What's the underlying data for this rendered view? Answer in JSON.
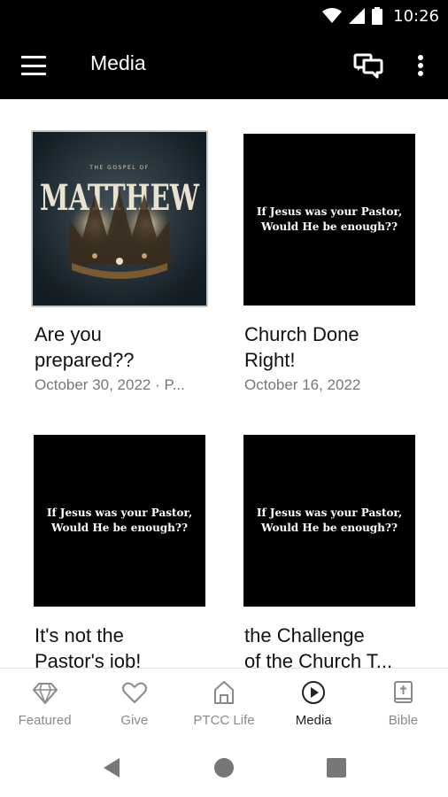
{
  "status_bar": {
    "time": "10:26"
  },
  "app_bar": {
    "title": "Media"
  },
  "thumbnail_text": "If Jesus was your Pastor,\nWould He be  enough??",
  "matthew_art": {
    "top": "THE GOSPEL OF",
    "word": "MATTHEW"
  },
  "media_items": [
    {
      "title": "Are you\nprepared??",
      "date": "October 30, 2022 · P..."
    },
    {
      "title": "Church Done\nRight!",
      "date": "October 16, 2022"
    },
    {
      "title": "It's not the\nPastor's job!",
      "date": ""
    },
    {
      "title": "the Challenge\nof the Church T...",
      "date": ""
    }
  ],
  "bottom_nav": [
    {
      "label": "Featured",
      "icon": "diamond-icon"
    },
    {
      "label": "Give",
      "icon": "heart-icon"
    },
    {
      "label": "PTCC Life",
      "icon": "home-icon"
    },
    {
      "label": "Media",
      "icon": "play-circle-icon",
      "active": true
    },
    {
      "label": "Bible",
      "icon": "bible-icon"
    }
  ],
  "colors": {
    "bar": "#000000",
    "active_label": "#222222",
    "inactive_label": "#8a8a8a"
  }
}
